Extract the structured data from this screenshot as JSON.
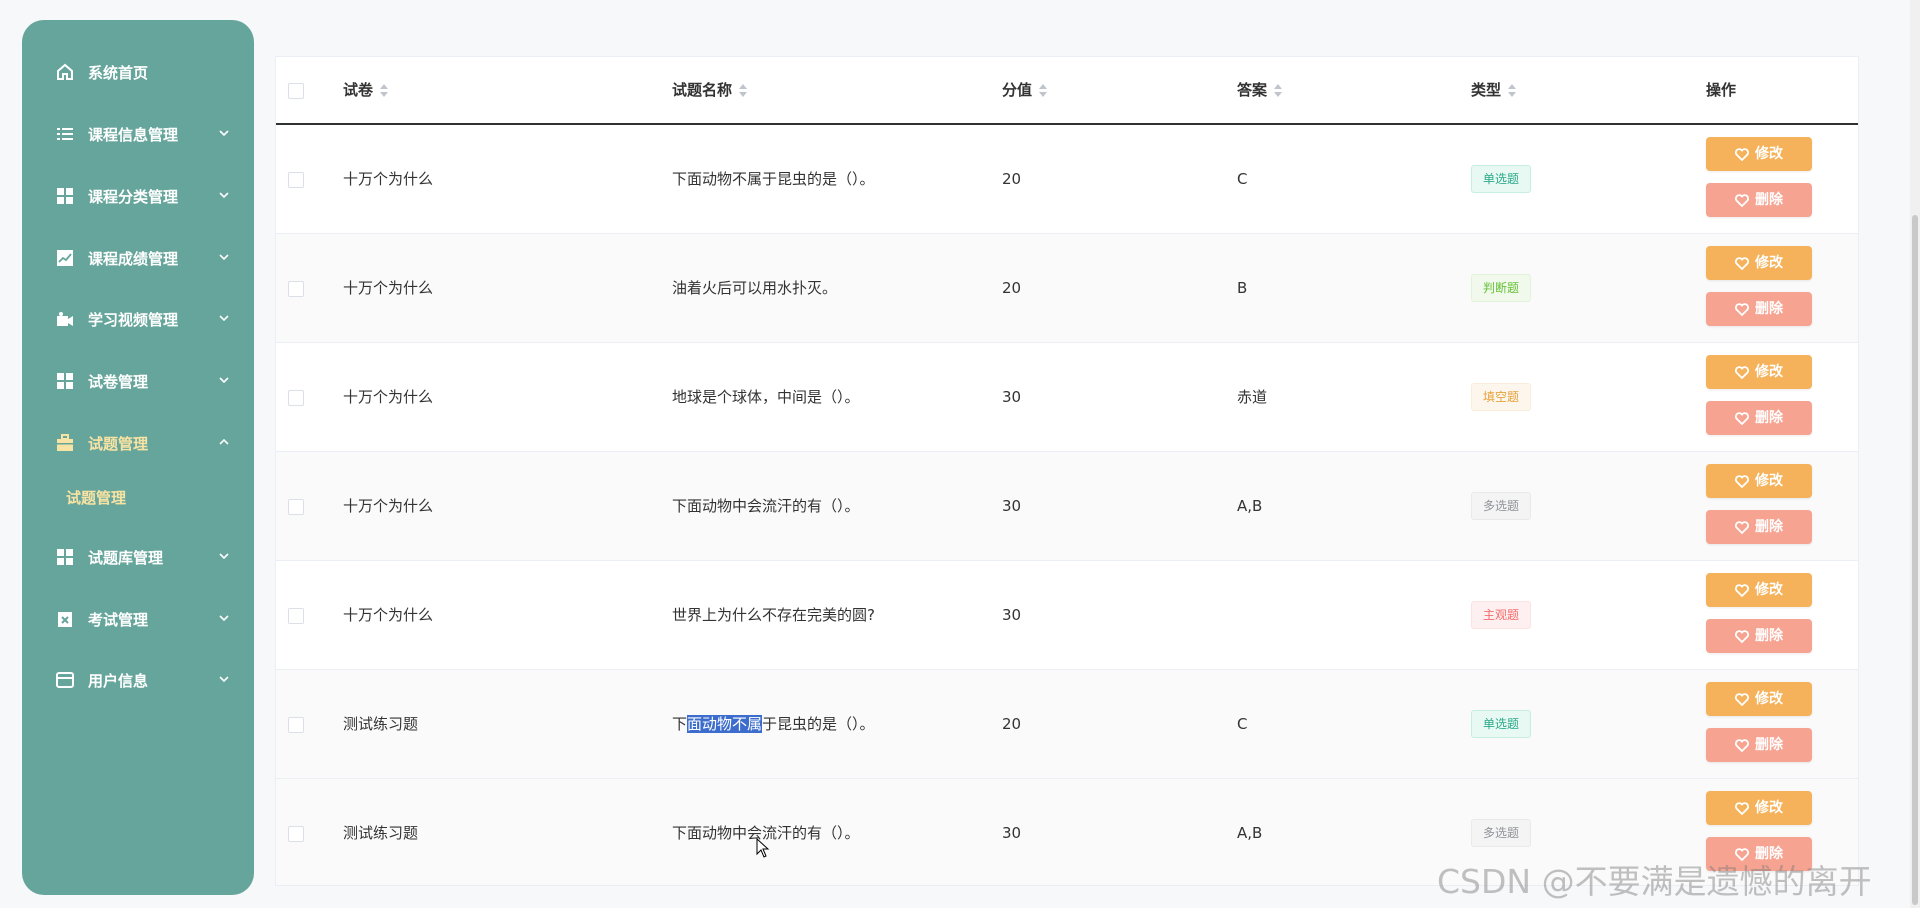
{
  "sidebar": {
    "items": [
      {
        "label": "系统首页",
        "icon": "home-icon"
      },
      {
        "label": "课程信息管理",
        "icon": "list-icon"
      },
      {
        "label": "课程分类管理",
        "icon": "grid-icon"
      },
      {
        "label": "课程成绩管理",
        "icon": "chart-icon"
      },
      {
        "label": "学习视频管理",
        "icon": "video-icon"
      },
      {
        "label": "试卷管理",
        "icon": "grid-icon"
      },
      {
        "label": "试题管理",
        "icon": "briefcase-icon"
      },
      {
        "label": "试题库管理",
        "icon": "grid-icon"
      },
      {
        "label": "考试管理",
        "icon": "clipboard-icon"
      },
      {
        "label": "用户信息",
        "icon": "card-icon"
      }
    ],
    "sub_item": "试题管理"
  },
  "table": {
    "headers": [
      "试卷",
      "试题名称",
      "分值",
      "答案",
      "类型",
      "操作"
    ],
    "rows": [
      {
        "paper": "十万个为什么",
        "name": "下面动物不属于昆虫的是（）。",
        "score": "20",
        "answer": "C",
        "type": "单选题"
      },
      {
        "paper": "十万个为什么",
        "name": "油着火后可以用水扑灭。",
        "score": "20",
        "answer": "B",
        "type": "判断题"
      },
      {
        "paper": "十万个为什么",
        "name": "地球是个球体，中间是（）。",
        "score": "30",
        "answer": "赤道",
        "type": "填空题"
      },
      {
        "paper": "十万个为什么",
        "name": "下面动物中会流汗的有（）。",
        "score": "30",
        "answer": "A,B",
        "type": "多选题"
      },
      {
        "paper": "十万个为什么",
        "name": "世界上为什么不存在完美的圆?",
        "score": "30",
        "answer": "",
        "type": "主观题"
      },
      {
        "paper": "测试练习题",
        "name_parts": [
          "下",
          "面动物不属",
          "于昆虫的是（）。"
        ],
        "score": "20",
        "answer": "C",
        "type": "单选题"
      },
      {
        "paper": "测试练习题",
        "name": "下面动物中会流汗的有（）。",
        "score": "30",
        "answer": "A,B",
        "type": "多选题"
      }
    ],
    "edit_label": "修改",
    "delete_label": "删除"
  },
  "watermark": "CSDN @不要满是遗憾的离开",
  "colors": {
    "sidebar_bg": "#66a59b",
    "edit_button": "#f5b25a",
    "delete_button": "#f7a391",
    "active_text": "#f7e3a3"
  }
}
